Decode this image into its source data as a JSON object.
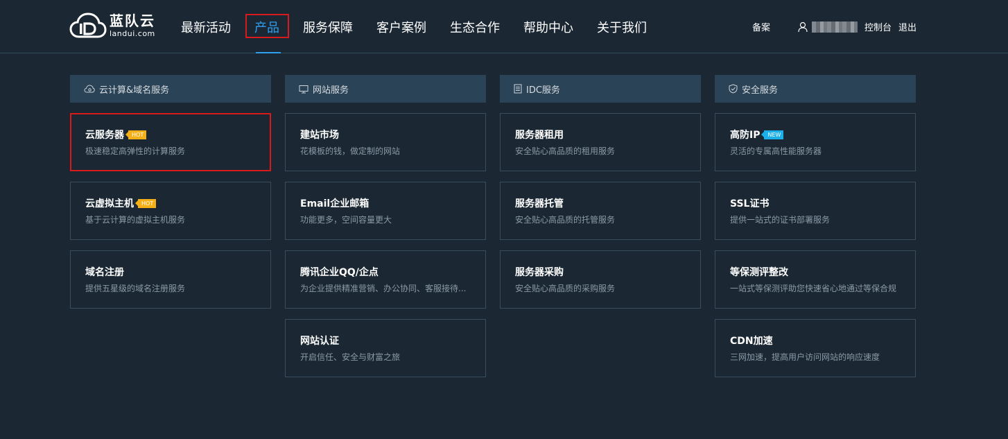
{
  "logo": {
    "cn": "蓝队云",
    "en": "landui.com"
  },
  "nav": [
    {
      "label": "最新活动"
    },
    {
      "label": "产品"
    },
    {
      "label": "服务保障"
    },
    {
      "label": "客户案例"
    },
    {
      "label": "生态合作"
    },
    {
      "label": "帮助中心"
    },
    {
      "label": "关于我们"
    }
  ],
  "header_right": {
    "beian": "备案",
    "console": "控制台",
    "logout": "退出"
  },
  "colors": {
    "accent": "#2fa0f0",
    "highlight": "#d91a1a",
    "hot": "#f5b017",
    "new": "#1bb0ea"
  },
  "columns": [
    {
      "title": "云计算&域名服务",
      "icon": "cloud-gear-icon",
      "items": [
        {
          "title": "云服务器",
          "badge": "HOT",
          "desc": "极速稳定高弹性的计算服务"
        },
        {
          "title": "云虚拟主机",
          "badge": "HOT",
          "desc": "基于云计算的虚拟主机服务"
        },
        {
          "title": "域名注册",
          "desc": "提供五星级的域名注册服务"
        }
      ]
    },
    {
      "title": "网站服务",
      "icon": "monitor-icon",
      "items": [
        {
          "title": "建站市场",
          "desc": "花模板的钱，做定制的网站"
        },
        {
          "title": "Email企业邮箱",
          "desc": "功能更多，空间容量更大"
        },
        {
          "title": "腾讯企业QQ/企点",
          "desc": "为企业提供精准营销、办公协同、客服接待..."
        },
        {
          "title": "网站认证",
          "desc": "开启信任、安全与财富之旅"
        }
      ]
    },
    {
      "title": "IDC服务",
      "icon": "server-icon",
      "items": [
        {
          "title": "服务器租用",
          "desc": "安全贴心高品质的租用服务"
        },
        {
          "title": "服务器托管",
          "desc": "安全贴心高品质的托管服务"
        },
        {
          "title": "服务器采购",
          "desc": "安全贴心高品质的采购服务"
        }
      ]
    },
    {
      "title": "安全服务",
      "icon": "shield-icon",
      "items": [
        {
          "title": "高防IP",
          "badge": "NEW",
          "desc": "灵活的专属高性能服务器"
        },
        {
          "title": "SSL证书",
          "desc": "提供一站式的证书部署服务"
        },
        {
          "title": "等保测评整改",
          "desc": "一站式等保测评助您快速省心地通过等保合规"
        },
        {
          "title": "CDN加速",
          "desc": "三网加速，提高用户访问网站的响应速度"
        }
      ]
    }
  ]
}
